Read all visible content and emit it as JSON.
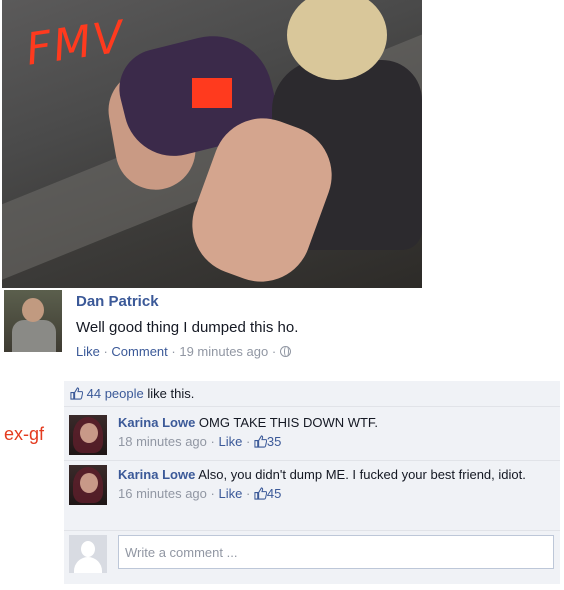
{
  "photo": {
    "overlay_text": "FMV",
    "accent": "#ff3a1e"
  },
  "post": {
    "author": "Dan Patrick",
    "text": "Well good thing I dumped this ho.",
    "like_label": "Like",
    "comment_label": "Comment",
    "timestamp": "19 minutes ago",
    "separator": " · ",
    "privacy_icon": "globe-icon"
  },
  "likes": {
    "icon": "thumbs-up-icon",
    "count_text": "44 people",
    "tail_text": " like this."
  },
  "annotation": {
    "label": "ex-gf",
    "color": "#e43b1f"
  },
  "comments": [
    {
      "author": "Karina Lowe",
      "text": "OMG TAKE THIS DOWN WTF.",
      "timestamp": "18 minutes ago",
      "like_label": "Like",
      "like_count": "35"
    },
    {
      "author": "Karina Lowe",
      "text": "Also, you didn't dump ME. I fucked your best friend, idiot.",
      "timestamp": "16 minutes ago",
      "like_label": "Like",
      "like_count": "45"
    }
  ],
  "reply": {
    "placeholder": "Write a comment ..."
  },
  "colors": {
    "link": "#3b5998",
    "meta": "#9197a3",
    "ufi_bg": "#f0f2f6"
  }
}
